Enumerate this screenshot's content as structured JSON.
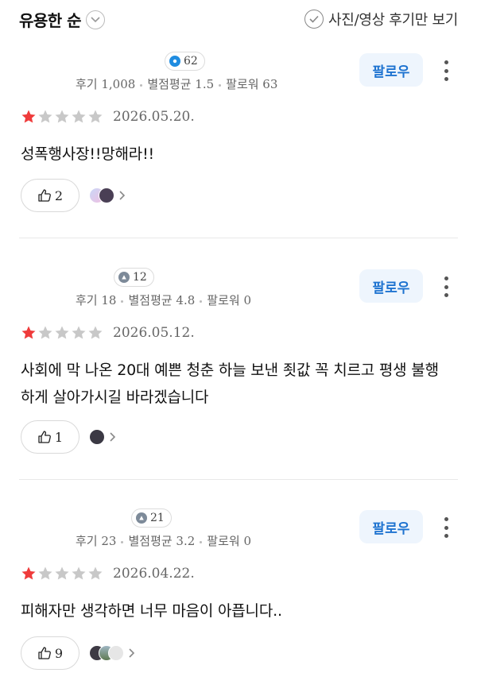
{
  "sort": {
    "label": "유용한 순"
  },
  "filter": {
    "label": "사진/영상 후기만 보기"
  },
  "follow_label": "팔로우",
  "reviews": [
    {
      "badge_count": "62",
      "badge_color": "#1f8ce0",
      "reviews": "후기 1,008",
      "avg": "별점평균 1.5",
      "followers": "팔로워 63",
      "rating": 1,
      "date": "2026.05.20.",
      "text": "성폭행사장!!망해라!!",
      "likes": "2",
      "avatars": [
        "#e9c7ea",
        "#4a3f55"
      ]
    },
    {
      "badge_count": "12",
      "badge_color": "#7d8a99",
      "reviews": "후기 18",
      "avg": "별점평균 4.8",
      "followers": "팔로워 0",
      "rating": 1,
      "date": "2026.05.12.",
      "text": "사회에 막 나온 20대 예쁜 청춘 하늘 보낸 죗값 꼭 치르고 평생 불행하게 살아가시길 바라겠습니다",
      "likes": "1",
      "avatars": [
        "#3b3944"
      ]
    },
    {
      "badge_count": "21",
      "badge_color": "#7d8a99",
      "reviews": "후기 23",
      "avg": "별점평균 3.2",
      "followers": "팔로워 0",
      "rating": 1,
      "date": "2026.04.22.",
      "text": "피해자만 생각하면 너무 마음이 아픕니다..",
      "likes": "9",
      "avatars": [
        "#3d3a44",
        "#7a9aa8",
        "#d9d9d9"
      ]
    }
  ],
  "colors": {
    "star_on": "#ef3b3b",
    "star_off": "#c8c8c8",
    "follow_text": "#1e73d0",
    "follow_bg": "#eef5fd"
  }
}
